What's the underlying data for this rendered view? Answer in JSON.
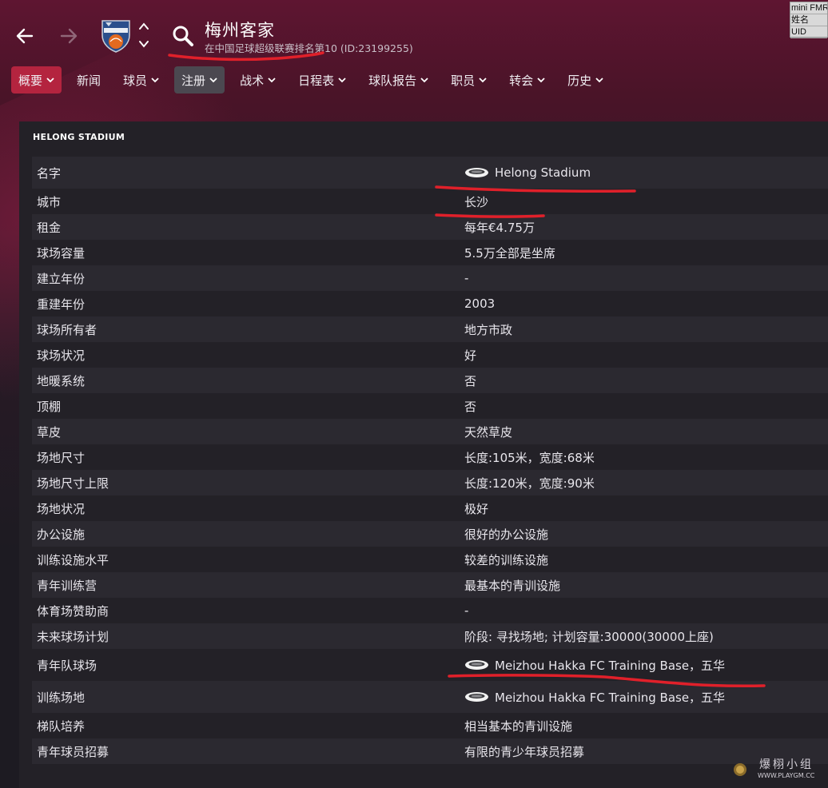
{
  "header": {
    "club_name": "梅州客家",
    "club_subtitle": "在中国足球超级联赛排名第10 (ID:23199255)"
  },
  "mini_panel": [
    "mini FMR",
    "姓名",
    "UID"
  ],
  "tabs": [
    {
      "label": "概要",
      "has_menu": true,
      "state": "active"
    },
    {
      "label": "新闻",
      "has_menu": false,
      "state": "normal"
    },
    {
      "label": "球员",
      "has_menu": true,
      "state": "normal"
    },
    {
      "label": "注册",
      "has_menu": true,
      "state": "hover"
    },
    {
      "label": "战术",
      "has_menu": true,
      "state": "normal"
    },
    {
      "label": "日程表",
      "has_menu": true,
      "state": "normal"
    },
    {
      "label": "球队报告",
      "has_menu": true,
      "state": "normal"
    },
    {
      "label": "职员",
      "has_menu": true,
      "state": "normal"
    },
    {
      "label": "转会",
      "has_menu": true,
      "state": "normal"
    },
    {
      "label": "历史",
      "has_menu": true,
      "state": "normal"
    }
  ],
  "panel": {
    "title": "HELONG STADIUM",
    "rows": [
      {
        "label": "名字",
        "value": "Helong Stadium",
        "icon": "stadium-icon",
        "link": true
      },
      {
        "label": "城市",
        "value": "长沙"
      },
      {
        "label": "租金",
        "value": "每年€4.75万"
      },
      {
        "label": "球场容量",
        "value": "5.5万全部是坐席"
      },
      {
        "label": "建立年份",
        "value": "-"
      },
      {
        "label": "重建年份",
        "value": "2003"
      },
      {
        "label": "球场所有者",
        "value": "地方市政"
      },
      {
        "label": "球场状况",
        "value": "好"
      },
      {
        "label": "地暖系统",
        "value": "否"
      },
      {
        "label": "顶棚",
        "value": "否"
      },
      {
        "label": "草皮",
        "value": "天然草皮"
      },
      {
        "label": "场地尺寸",
        "value": "长度:105米，宽度:68米"
      },
      {
        "label": "场地尺寸上限",
        "value": "长度:120米，宽度:90米"
      },
      {
        "label": "场地状况",
        "value": "极好"
      },
      {
        "label": "办公设施",
        "value": "很好的办公设施"
      },
      {
        "label": "训练设施水平",
        "value": "较差的训练设施"
      },
      {
        "label": "青年训练营",
        "value": "最基本的青训设施"
      },
      {
        "label": "体育场赞助商",
        "value": "-"
      },
      {
        "label": "未来球场计划",
        "value": "阶段: 寻找场地; 计划容量:30000(30000上座)"
      },
      {
        "label": "青年队球场",
        "value": "Meizhou Hakka FC Training Base，五华",
        "icon": "stadium-icon",
        "link": true
      },
      {
        "label": "训练场地",
        "value": "Meizhou Hakka FC Training Base，五华",
        "icon": "stadium-icon",
        "link": true
      },
      {
        "label": "梯队培养",
        "value": "相当基本的青训设施"
      },
      {
        "label": "青年球员招募",
        "value": "有限的青少年球员招募"
      }
    ]
  },
  "watermark": {
    "text": "爆栩小组",
    "url": "WWW.PLAYGM.CC"
  },
  "colors": {
    "accent_red": "#b4243f",
    "hover_grey": "#4b4850",
    "panel_bg": "#232127",
    "row_alt": "#2b2930",
    "annotation_red": "#e0202a"
  }
}
